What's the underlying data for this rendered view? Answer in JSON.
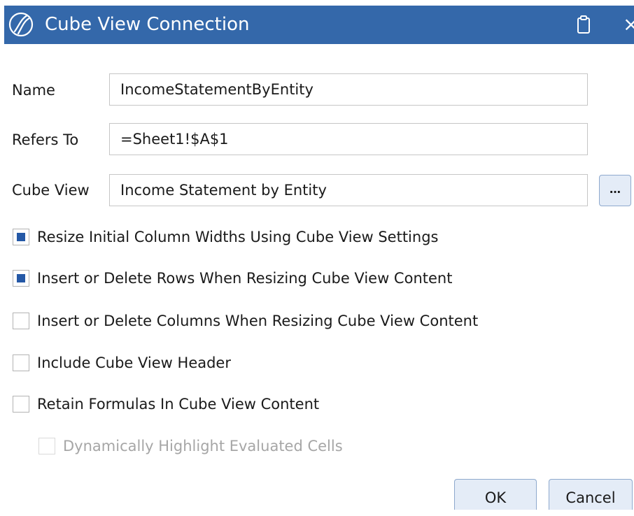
{
  "window": {
    "title": "Cube View Connection",
    "accent_color": "#3468aa",
    "icons": [
      "app-logo-icon",
      "clipboard-icon",
      "close-icon"
    ],
    "close_glyph": "×"
  },
  "form": {
    "name": {
      "label": "Name",
      "value": "IncomeStatementByEntity"
    },
    "refers_to": {
      "label": "Refers To",
      "value": "=Sheet1!$A$1"
    },
    "cube_view": {
      "label": "Cube View",
      "value": "Income Statement by Entity",
      "browse_label": "…"
    }
  },
  "options": [
    {
      "label": "Resize Initial Column Widths Using Cube View Settings",
      "checked": true,
      "enabled": true
    },
    {
      "label": "Insert or Delete Rows When Resizing Cube View Content",
      "checked": true,
      "enabled": true
    },
    {
      "label": "Insert or Delete Columns When Resizing Cube View Content",
      "checked": false,
      "enabled": true
    },
    {
      "label": "Include Cube View Header",
      "checked": false,
      "enabled": true
    },
    {
      "label": "Retain Formulas In Cube View Content",
      "checked": false,
      "enabled": true
    },
    {
      "label": "Dynamically Highlight Evaluated Cells",
      "checked": false,
      "enabled": false
    }
  ],
  "buttons": {
    "ok": "OK",
    "cancel": "Cancel"
  }
}
